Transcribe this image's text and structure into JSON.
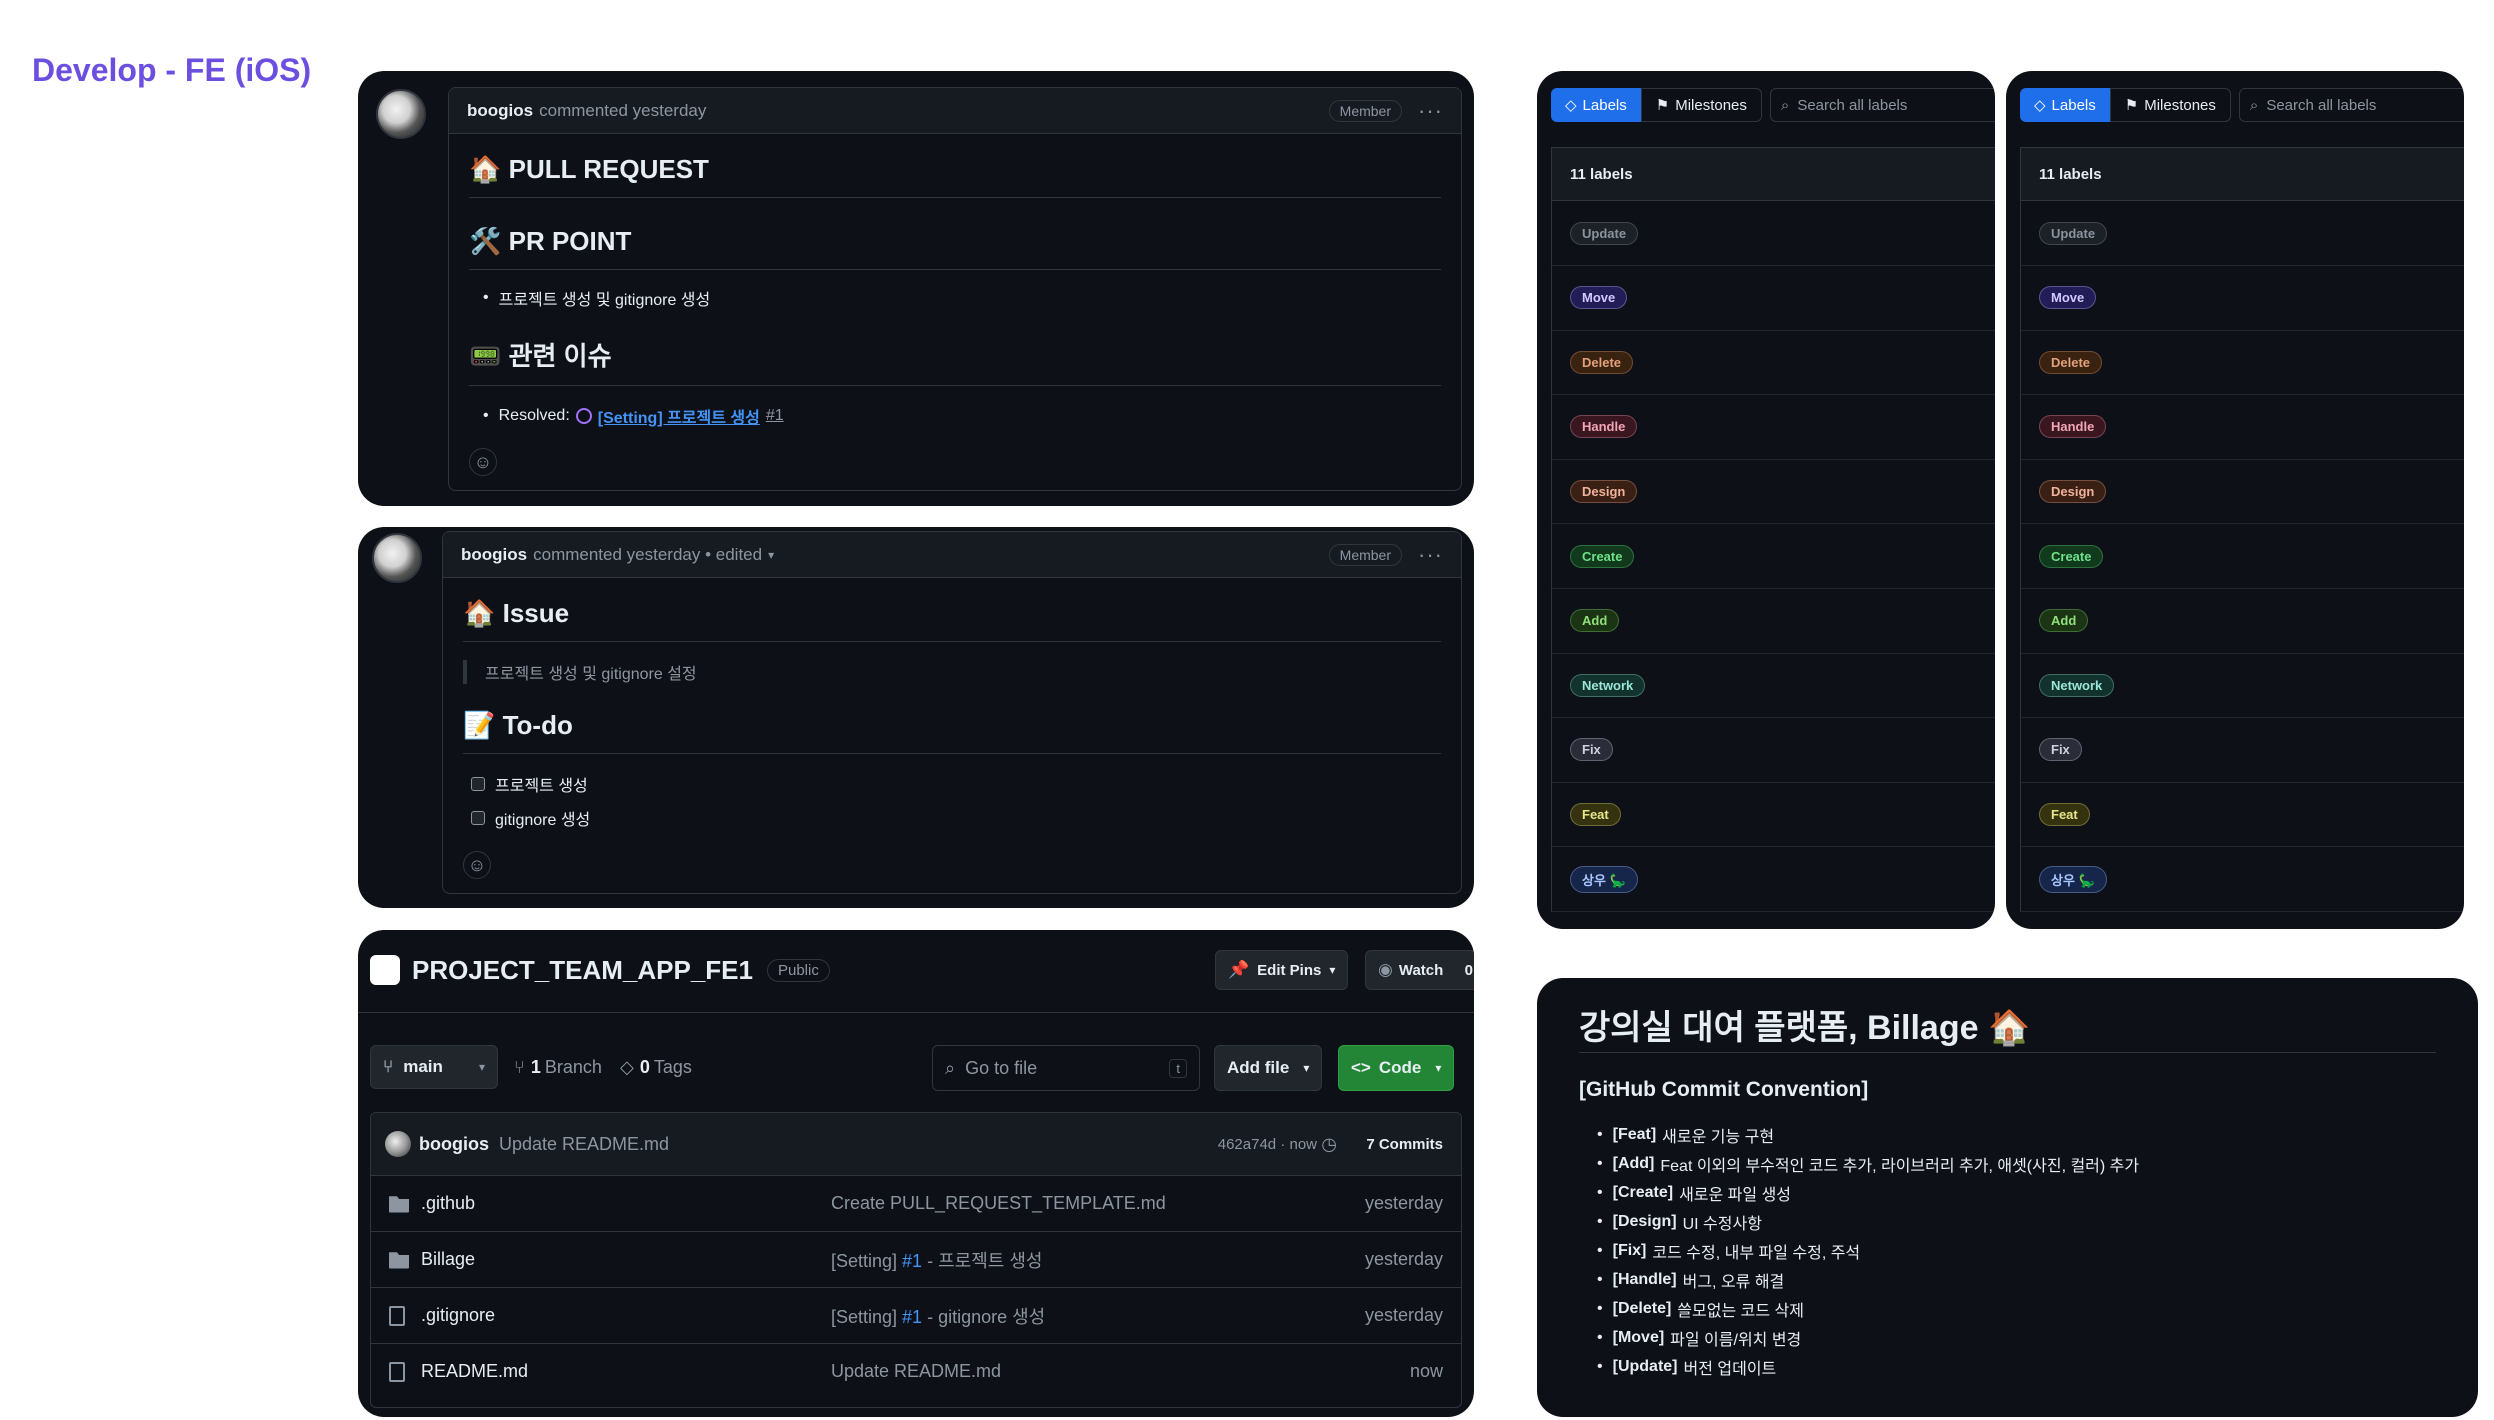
{
  "page": {
    "title": "Develop - FE (iOS)"
  },
  "comment1": {
    "author": "boogios",
    "action": "commented yesterday",
    "badge": "Member",
    "h_pull_request": "🏠 PULL REQUEST",
    "h_pr_point": "🛠️ PR POINT",
    "pr_point_item": "프로젝트 생성 및 gitignore 생성",
    "h_related_issue": "📟 관련 이슈",
    "resolved_label": "Resolved:",
    "resolved_link": "[Setting] 프로젝트 생성",
    "resolved_num": "#1"
  },
  "comment2": {
    "author": "boogios",
    "action": "commented yesterday • edited",
    "badge": "Member",
    "h_issue": "🏠 Issue",
    "quote": "프로젝트 생성 및 gitignore 설정",
    "h_todo": "📝 To-do",
    "todos": [
      "프로젝트 생성",
      "gitignore 생성"
    ]
  },
  "repo": {
    "name": "PROJECT_TEAM_APP_FE1",
    "visibility": "Public",
    "edit_pins": "Edit Pins",
    "watch": "Watch",
    "watch_count": "0",
    "branch_select": "main",
    "branches_count": "1",
    "branches_label": "Branch",
    "tags_count": "0",
    "tags_label": "Tags",
    "goto_placeholder": "Go to file",
    "goto_key": "t",
    "add_file": "Add file",
    "code": "Code",
    "latest_author": "boogios",
    "latest_message": "Update README.md",
    "latest_hash": "462a74d · now",
    "commits": "7 Commits",
    "files": [
      {
        "type": "folder",
        "name": ".github",
        "msg_pre": "Create PULL_REQUEST_TEMPLATE.md",
        "msg_link": "",
        "msg_post": "",
        "time": "yesterday"
      },
      {
        "type": "folder",
        "name": "Billage",
        "msg_pre": "[Setting] ",
        "msg_link": "#1",
        "msg_post": " - 프로젝트 생성",
        "time": "yesterday"
      },
      {
        "type": "file",
        "name": ".gitignore",
        "msg_pre": "[Setting] ",
        "msg_link": "#1",
        "msg_post": " - gitignore 생성",
        "time": "yesterday"
      },
      {
        "type": "file",
        "name": "README.md",
        "msg_pre": "Update README.md",
        "msg_link": "",
        "msg_post": "",
        "time": "now"
      }
    ]
  },
  "labels_panel": {
    "tab_labels": "Labels",
    "tab_milestones": "Milestones",
    "search_placeholder": "Search all labels",
    "count_text": "11 labels",
    "labels": [
      {
        "name": "Update",
        "color": "#8b949e",
        "bg": "#1c2128"
      },
      {
        "name": "Move",
        "color": "#d2c9ff",
        "bg": "#231d57"
      },
      {
        "name": "Delete",
        "color": "#e3a07a",
        "bg": "#3a2210"
      },
      {
        "name": "Handle",
        "color": "#f2a5b5",
        "bg": "#3a1620"
      },
      {
        "name": "Design",
        "color": "#f0b29a",
        "bg": "#3a1f14"
      },
      {
        "name": "Create",
        "color": "#6fe08a",
        "bg": "#113a1c"
      },
      {
        "name": "Add",
        "color": "#8fe07a",
        "bg": "#1a3414"
      },
      {
        "name": "Network",
        "color": "#9ae6d8",
        "bg": "#12332d"
      },
      {
        "name": "Fix",
        "color": "#d0d0e0",
        "bg": "#2a2c38"
      },
      {
        "name": "Feat",
        "color": "#e7e48a",
        "bg": "#35330f"
      },
      {
        "name": "상우 🦕",
        "color": "#a9c8ff",
        "bg": "#16264a"
      }
    ]
  },
  "convention": {
    "title": "강의실 대여 플랫폼, Billage 🏠",
    "subtitle": "[GitHub Commit Convention]",
    "items": [
      {
        "tag": "[Feat]",
        "desc": "새로운 기능 구현"
      },
      {
        "tag": "[Add]",
        "desc": "Feat 이외의 부수적인 코드 추가, 라이브러리 추가, 애셋(사진, 컬러) 추가"
      },
      {
        "tag": "[Create]",
        "desc": "새로운 파일 생성"
      },
      {
        "tag": "[Design]",
        "desc": "UI 수정사항"
      },
      {
        "tag": "[Fix]",
        "desc": "코드 수정, 내부 파일 수정, 주석"
      },
      {
        "tag": "[Handle]",
        "desc": "버그, 오류 해결"
      },
      {
        "tag": "[Delete]",
        "desc": "쓸모없는 코드 삭제"
      },
      {
        "tag": "[Move]",
        "desc": "파일 이름/위치 변경"
      },
      {
        "tag": "[Update]",
        "desc": "버전 업데이트"
      }
    ]
  }
}
